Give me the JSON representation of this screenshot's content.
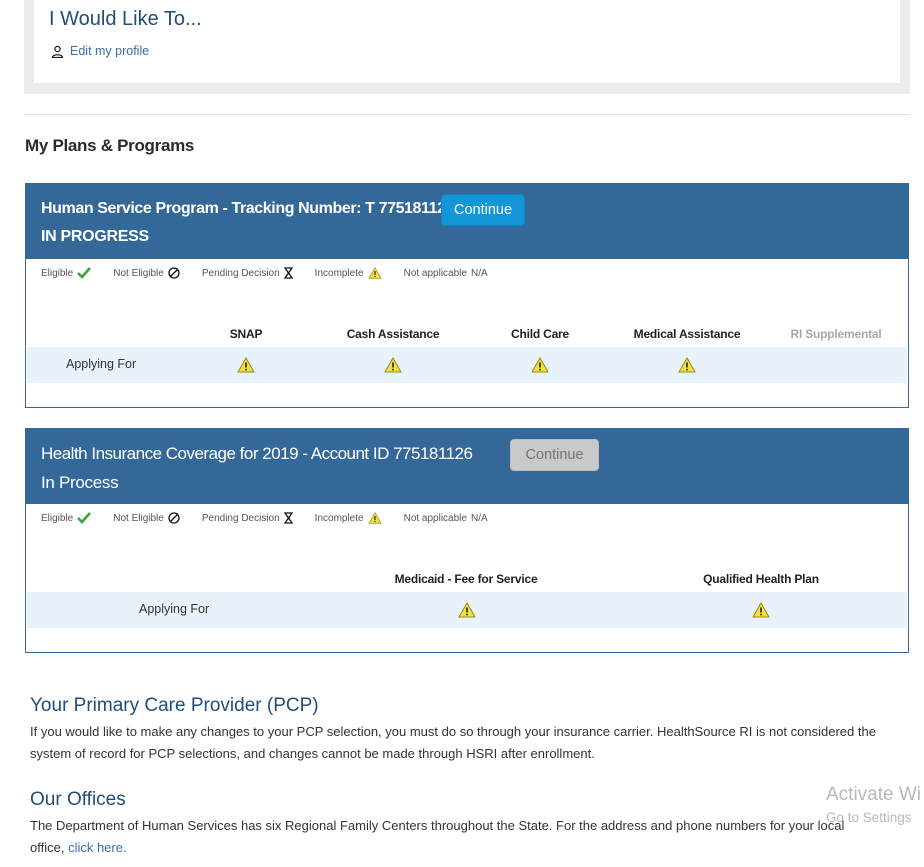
{
  "quick_actions": {
    "title": "I Would Like To...",
    "edit_profile": "Edit my profile"
  },
  "section_title": "My Plans & Programs",
  "legend": {
    "eligible": "Eligible",
    "not_eligible": "Not Eligible",
    "pending": "Pending Decision",
    "incomplete": "Incomplete",
    "not_applicable": "Not applicable",
    "na": "N/A"
  },
  "plan1": {
    "title": "Human Service Program - Tracking Number: T 775181127",
    "status": "IN PROGRESS",
    "continue": "Continue",
    "programs": [
      "SNAP",
      "Cash Assistance",
      "Child Care",
      "Medical Assistance",
      "RI Supplemental"
    ],
    "row_label": "Applying For"
  },
  "plan2": {
    "title": "Health Insurance Coverage for 2019 - Account ID 775181126",
    "status": "In Process",
    "continue": "Continue",
    "programs": [
      "Medicaid - Fee for Service",
      "Qualified Health Plan"
    ],
    "row_label": "Applying For"
  },
  "pcp": {
    "title": "Your Primary Care Provider (PCP)",
    "text": "If you would like to make any changes to your PCP selection, you must do so through your insurance carrier. HealthSource RI is not considered the system of record for PCP selections, and changes cannot be made through HSRI after enrollment."
  },
  "offices": {
    "title": "Our Offices",
    "text": "The Department of Human Services has six Regional Family Centers throughout the State. For the address and phone numbers for your local office, ",
    "link": "click here."
  },
  "watermark": {
    "line1": "Activate Wi",
    "line2": "Go to Settings"
  },
  "colors": {
    "header_blue": "#346899",
    "button_blue": "#1296d8",
    "band": "#e8f2fa"
  }
}
